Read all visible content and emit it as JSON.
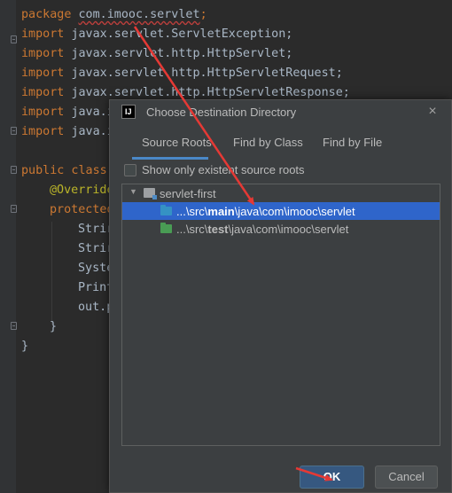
{
  "code_lines": [
    {
      "kw": "package ",
      "rest": "com.imooc.servlet",
      "tail": ";"
    },
    {
      "kw": "import ",
      "rest": "javax.servlet.ServletException;"
    },
    {
      "kw": "import ",
      "rest": "javax.servlet.http.HttpServlet;"
    },
    {
      "kw": "import ",
      "rest": "javax.servlet.http.HttpServletRequest;"
    },
    {
      "kw": "import ",
      "rest": "javax.servlet.http.HttpServletResponse;"
    },
    {
      "kw": "import ",
      "rest": "java.i"
    },
    {
      "kw": "import ",
      "rest": "java.i"
    },
    {
      "kw": "public class ",
      "rest": ""
    },
    {
      "ann": "@Override"
    },
    {
      "kw": "protected",
      "rest": ""
    },
    {
      "rest": "Strir"
    },
    {
      "rest": "Strir"
    },
    {
      "rest": "Syste"
    },
    {
      "rest": "Print"
    },
    {
      "rest": "out.p"
    },
    {
      "rest": "}"
    },
    {
      "rest": "}"
    }
  ],
  "dialog": {
    "title": "Choose Destination Directory",
    "app_icon": "IJ",
    "close_icon": "×",
    "tabs": [
      "Source Roots",
      "Find by Class",
      "Find by File"
    ],
    "active_tab": "Source Roots",
    "checkbox_label": "Show only existent source roots",
    "checkbox_checked": false,
    "tree": {
      "root": "servlet-first",
      "rows": [
        {
          "prefix": "...\\src\\",
          "bold": "main",
          "suffix": "\\java\\com\\imooc\\servlet",
          "selected": true,
          "folder_color": "#3592c4"
        },
        {
          "prefix": "...\\src\\",
          "bold": "test",
          "suffix": "\\java\\com\\imooc\\servlet",
          "selected": false,
          "folder_color": "#499c54"
        }
      ]
    },
    "ok_label": "OK",
    "cancel_label": "Cancel"
  },
  "colors": {
    "keyword": "#cc7832",
    "annotation": "#bbb529",
    "selection": "#2f65ca",
    "arrow": "#e53935"
  }
}
